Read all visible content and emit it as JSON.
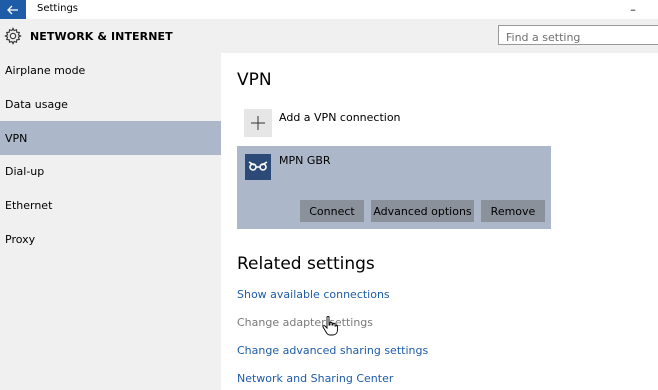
{
  "window": {
    "title": "Settings",
    "minimize_glyph": "–"
  },
  "header": {
    "title": "NETWORK & INTERNET",
    "search_placeholder": "Find a setting"
  },
  "sidebar": {
    "items": [
      {
        "label": "Airplane mode",
        "selected": false
      },
      {
        "label": "Data usage",
        "selected": false
      },
      {
        "label": "VPN",
        "selected": true
      },
      {
        "label": "Dial-up",
        "selected": false
      },
      {
        "label": "Ethernet",
        "selected": false
      },
      {
        "label": "Proxy",
        "selected": false
      }
    ]
  },
  "main": {
    "vpn_title": "VPN",
    "add_vpn_label": "Add a VPN connection",
    "vpn_connection": {
      "name": "MPN GBR",
      "connect_label": "Connect",
      "advanced_label": "Advanced options",
      "remove_label": "Remove"
    },
    "related_title": "Related settings",
    "related_links": [
      {
        "label": "Show available connections",
        "enabled": true
      },
      {
        "label": "Change adapter settings",
        "enabled": false
      },
      {
        "label": "Change advanced sharing settings",
        "enabled": true
      },
      {
        "label": "Network and Sharing Center",
        "enabled": true
      }
    ]
  },
  "colors": {
    "accent": "#1e5ca8",
    "selection": "#acb8ca",
    "sidebar_bg": "#f0f0f0"
  }
}
